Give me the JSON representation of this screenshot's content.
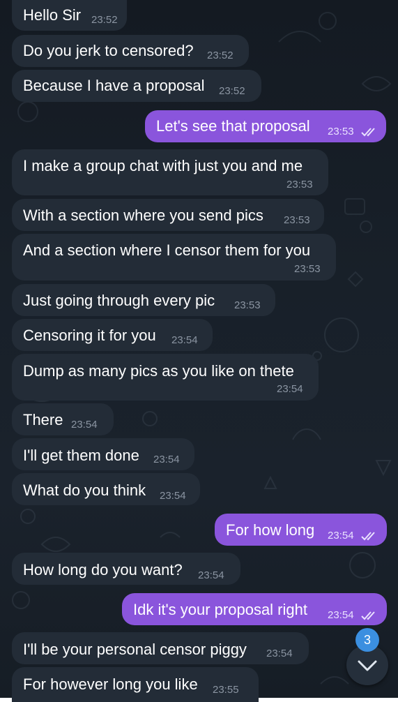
{
  "chat": {
    "messages": [
      {
        "direction": "in",
        "text": "Hello Sir",
        "time": "23:52"
      },
      {
        "direction": "in",
        "text": "Do you jerk to censored?",
        "time": "23:52"
      },
      {
        "direction": "in",
        "text": "Because I have a proposal",
        "time": "23:52"
      },
      {
        "direction": "out",
        "text": "Let's see that proposal",
        "time": "23:53",
        "status": "read"
      },
      {
        "direction": "in",
        "text": "I make a group chat with just you and me",
        "time": "23:53"
      },
      {
        "direction": "in",
        "text": "With a section where you send pics",
        "time": "23:53"
      },
      {
        "direction": "in",
        "text": "And a section where I censor them for you",
        "time": "23:53"
      },
      {
        "direction": "in",
        "text": "Just going through every pic",
        "time": "23:53"
      },
      {
        "direction": "in",
        "text": "Censoring it for you",
        "time": "23:54"
      },
      {
        "direction": "in",
        "text": "Dump as many pics as you like on thete",
        "time": "23:54"
      },
      {
        "direction": "in",
        "text": "There",
        "time": "23:54"
      },
      {
        "direction": "in",
        "text": "I'll get them done",
        "time": "23:54"
      },
      {
        "direction": "in",
        "text": "What do you think",
        "time": "23:54"
      },
      {
        "direction": "out",
        "text": "For how long",
        "time": "23:54",
        "status": "read"
      },
      {
        "direction": "in",
        "text": "How long do you want?",
        "time": "23:54"
      },
      {
        "direction": "out",
        "text": "Idk it's your proposal right",
        "time": "23:54",
        "status": "read"
      },
      {
        "direction": "in",
        "text": "I'll be your personal censor piggy",
        "time": "23:54"
      },
      {
        "direction": "in",
        "text": "For however long you like",
        "time": "23:55"
      }
    ]
  },
  "scroll_button": {
    "icon": "chevron-down-icon",
    "unread_count": "3"
  },
  "colors": {
    "incoming_bubble": "#232c37",
    "outgoing_bubble": "#8a55dc",
    "background": "#182029",
    "badge": "#3b8fe0"
  }
}
